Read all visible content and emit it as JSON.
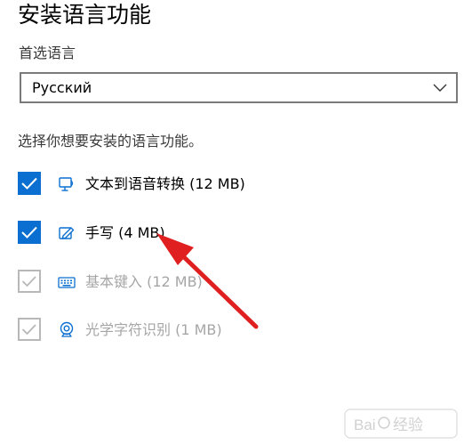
{
  "header": {
    "title": "安装语言功能"
  },
  "preferred_language": {
    "label": "首选语言",
    "selected": "Русский"
  },
  "instruction": "选择你想要安装的语言功能。",
  "features": [
    {
      "label": "文本到语音转换 (12 MB)",
      "checked": true,
      "enabled": true,
      "icon": "text-to-speech-icon"
    },
    {
      "label": "手写 (4 MB)",
      "checked": true,
      "enabled": true,
      "icon": "handwriting-pen-icon"
    },
    {
      "label": "基本键入 (12 MB)",
      "checked": true,
      "enabled": false,
      "icon": "keyboard-icon"
    },
    {
      "label": "光学字符识别 (1 MB)",
      "checked": true,
      "enabled": false,
      "icon": "webcam-ocr-icon"
    }
  ],
  "colors": {
    "checkbox_checked": "#0a6fd0",
    "checkbox_disabled": "#b8b8b8",
    "disabled_text": "#a6a6a6",
    "annotation_arrow": "#e02020"
  },
  "watermark": {
    "text": "Baidu 经验"
  }
}
